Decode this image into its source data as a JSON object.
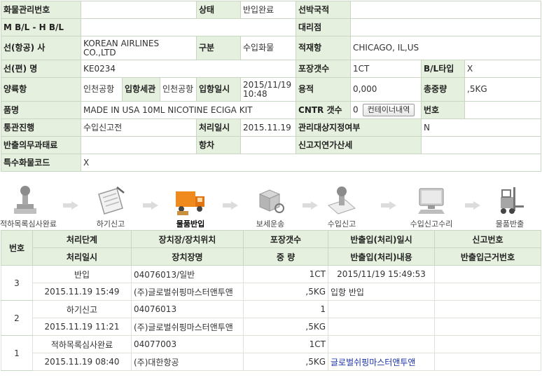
{
  "info": {
    "row1": {
      "l1": "화물관리번호",
      "v1": "",
      "l2": "상태",
      "v2": "반입완료",
      "l3": "선박국적",
      "v3": ""
    },
    "row2": {
      "l1": "M B/L - H B/L",
      "v1": "",
      "l3": "대리점",
      "v3": ""
    },
    "row3": {
      "l1": "선(항공) 사",
      "v1": "KOREAN AIRLINES CO.,LTD",
      "l2": "구분",
      "v2": "수입화물",
      "l3": "적재항",
      "v3": "CHICAGO, IL,US"
    },
    "row4": {
      "l1": "선(편) 명",
      "v1": "KE0234",
      "l2": "포장갯수",
      "v2": "1CT",
      "l3": "B/L타입",
      "v3": "X"
    },
    "row5": {
      "l1": "양륙항",
      "v1": "인천공항",
      "l1b": "입항세관",
      "v1b": "인천공항",
      "l2": "입항일시",
      "v2": "2015/11/19 10:48",
      "l3": "용적",
      "v3": "0,000",
      "l4": "총중량",
      "v4": ",5KG"
    },
    "row6": {
      "l1": "품명",
      "v1": "MADE IN USA 10ML NICOTINE ECIGA KIT",
      "l2": "CNTR 갯수",
      "v2": "0",
      "btn": "컨테이너내역",
      "l3": "번호",
      "v3": ""
    },
    "row7": {
      "l1": "통관진행",
      "v1": "수입신고전",
      "l2": "처리일시",
      "v2": "2015.11.19",
      "l3": "관리대상지정여부",
      "v3": "N"
    },
    "row8": {
      "l1": "반출의무과태료",
      "v1": "",
      "l2": "항차",
      "v2": "",
      "l3": "신고지연가산세",
      "v3": ""
    },
    "row9": {
      "l1": "특수화물코드",
      "v1": "X"
    }
  },
  "steps": [
    {
      "label": "적하목록심사완료",
      "icon": "stamp-icon"
    },
    {
      "label": "하기신고",
      "icon": "document-icon"
    },
    {
      "label": "물품반입",
      "icon": "truck-icon",
      "active": true
    },
    {
      "label": "보세운송",
      "icon": "boxes-icon"
    },
    {
      "label": "수입신고",
      "icon": "stamp-icon"
    },
    {
      "label": "수입신고수리",
      "icon": "computer-icon"
    },
    {
      "label": "물품반출",
      "icon": "forklift-icon"
    }
  ],
  "history": {
    "headers": {
      "no": "번호",
      "step": "처리단계",
      "place": "장치장/장치위치",
      "pkg": "포장갯수",
      "io": "반출입(처리)일시",
      "report": "신고번호",
      "step2": "처리일시",
      "place2": "장치장명",
      "pkg2": "중 량",
      "io2": "반출입(처리)내용",
      "report2": "반출입근거번호"
    },
    "rows": [
      {
        "no": "3",
        "step": "반입",
        "place": "04076013/일반",
        "pkg": "1CT",
        "io": "2015/11/19 15:49:53",
        "report": "",
        "date": "2015.11.19 15:49",
        "placeName": "(주)글로벌쉬핑마스터앤투앤",
        "weight": ",5KG",
        "content": "입항 반입",
        "basis": ""
      },
      {
        "no": "2",
        "step": "하기신고",
        "place": "04076013",
        "pkg": "1",
        "io": "",
        "report": "",
        "date": "2015.11.19 11:21",
        "placeName": "(주)글로벌쉬핑마스터앤투앤",
        "weight": ",5KG",
        "content": "",
        "basis": ""
      },
      {
        "no": "1",
        "step": "적하목록심사완료",
        "place": "04077003",
        "pkg": "1CT",
        "io": "",
        "report": "",
        "date": "2015.11.19 08:40",
        "placeName": "(주)대한항공",
        "weight": ",5KG",
        "content": "글로벌쉬핑마스터앤투앤",
        "basis": ""
      }
    ]
  },
  "colors": {
    "label_bg": "#e6f0de",
    "border": "#c9d6c4",
    "link": "#1a33a8",
    "truck": "#f08a1c"
  }
}
